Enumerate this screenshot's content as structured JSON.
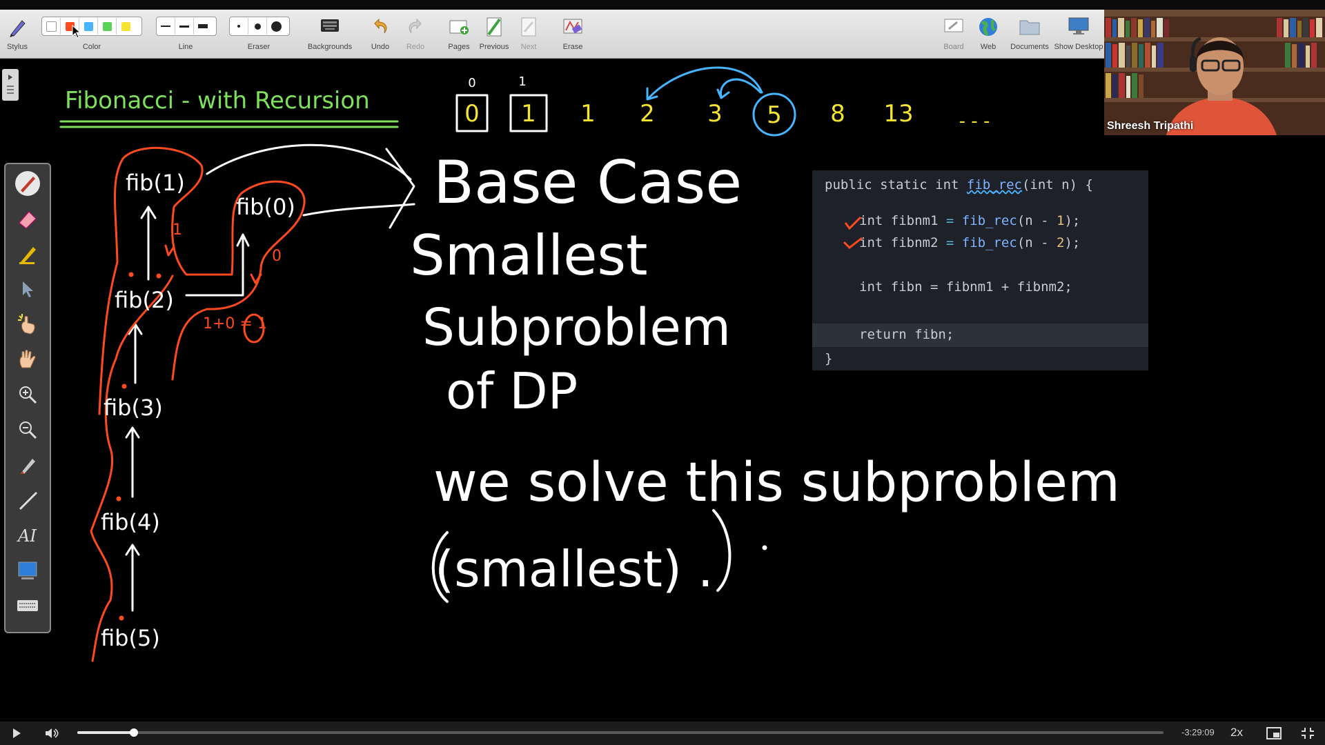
{
  "toolbar": {
    "stylus_label": "Stylus",
    "color_label": "Color",
    "line_label": "Line",
    "eraser_label": "Eraser",
    "backgrounds_label": "Backgrounds",
    "undo_label": "Undo",
    "redo_label": "Redo",
    "pages_label": "Pages",
    "previous_label": "Previous",
    "next_label": "Next",
    "erase_label": "Erase",
    "board_label": "Board",
    "web_label": "Web",
    "documents_label": "Documents",
    "show_desktop_label": "Show Desktop",
    "colors": [
      "#ffffff",
      "#ff4a1f",
      "#47b5ff",
      "#5bd35b",
      "#f5e431"
    ]
  },
  "whiteboard": {
    "title": "Fibonacci - with Recursion",
    "sequence": [
      "0",
      "1",
      "1",
      "2",
      "3",
      "5",
      "8",
      "13",
      "- - -"
    ],
    "sequence_marks": [
      "0",
      "1"
    ],
    "calls": [
      "fib(1)",
      "fib(0)",
      "fib(2)",
      "fib(3)",
      "fib(4)",
      "fib(5)"
    ],
    "return_values": [
      "1",
      "0"
    ],
    "sum_note": "1+0 = 1",
    "note_lines": [
      "Base Case",
      "Smallest",
      "Subproblem",
      "of DP",
      "we solve this subproblem",
      "(smallest) ."
    ]
  },
  "code": {
    "signature_prefix": "public static int ",
    "signature_name": "fib_rec",
    "signature_params": "(int n) {",
    "line1_type": "int ",
    "line1_var": "fibnm1",
    "line1_eq": " = ",
    "line1_call": "fib_rec",
    "line1_args": "(n - ",
    "line1_num": "1",
    "line1_end": ");",
    "line2_type": "int ",
    "line2_var": "fibnm2",
    "line2_eq": " = ",
    "line2_call": "fib_rec",
    "line2_args": "(n - ",
    "line2_num": "2",
    "line2_end": ");",
    "line3_type": "int ",
    "line3_var": "fibn",
    "line3_rest": " = fibnm1 + fibnm2;",
    "line4": "return fibn;",
    "close": "}"
  },
  "webcam": {
    "presenter_name": "Shreesh Tripathi"
  },
  "player": {
    "time_remaining": "-3:29:09",
    "speed": "2x",
    "progress": 0.052
  }
}
